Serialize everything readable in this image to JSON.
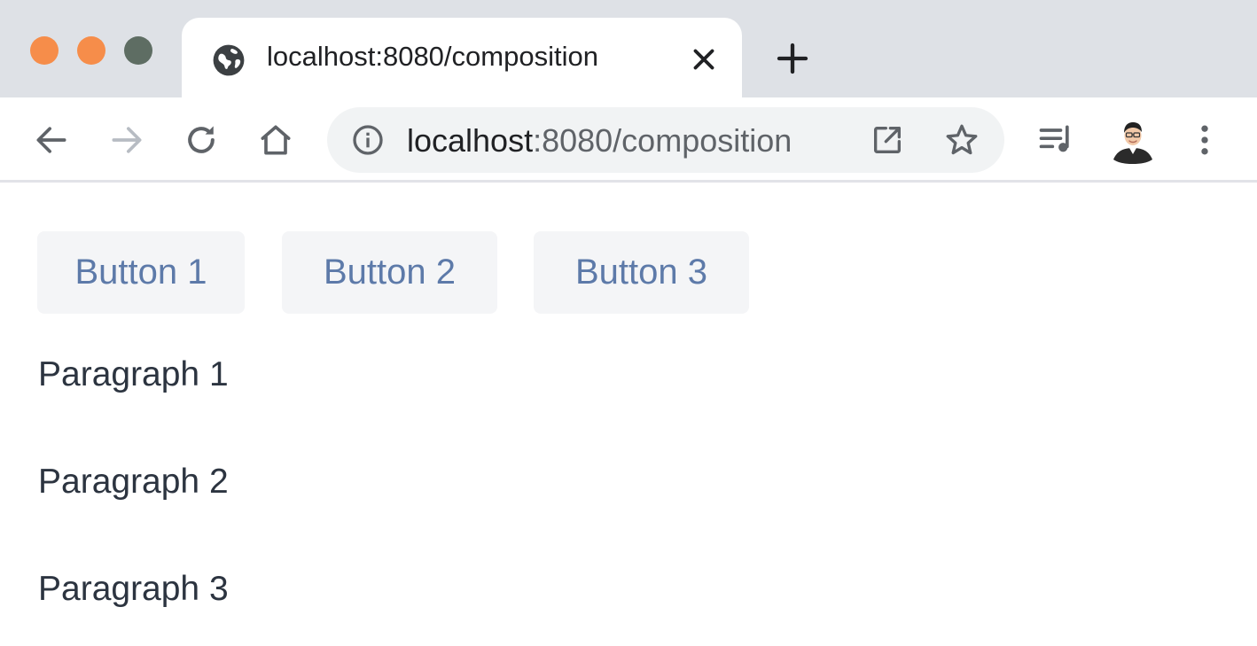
{
  "window": {
    "traffic_lights": {
      "close_color": "#f68d4a",
      "minimize_color": "#f68d4a",
      "maximize_color": "#5e6d63"
    }
  },
  "tab": {
    "title": "localhost:8080/composition",
    "favicon": "globe-icon",
    "close_icon": "close-icon"
  },
  "new_tab_icon": "plus-icon",
  "toolbar": {
    "back_icon": "arrow-left-icon",
    "forward_icon": "arrow-right-icon",
    "reload_icon": "reload-icon",
    "home_icon": "home-icon",
    "address": {
      "host": "localhost",
      "path": ":8080/composition",
      "site_info_icon": "info-icon",
      "open_in_icon": "open-external-icon",
      "bookmark_icon": "star-icon"
    },
    "media_icon": "media-queue-icon",
    "profile_icon": "avatar",
    "menu_icon": "more-vert-icon"
  },
  "page": {
    "buttons": [
      "Button 1",
      "Button 2",
      "Button 3"
    ],
    "paragraphs": [
      "Paragraph 1",
      "Paragraph 2",
      "Paragraph 3"
    ],
    "button_text_color": "#5d7aa9",
    "button_bg_color": "#f4f5f7"
  }
}
